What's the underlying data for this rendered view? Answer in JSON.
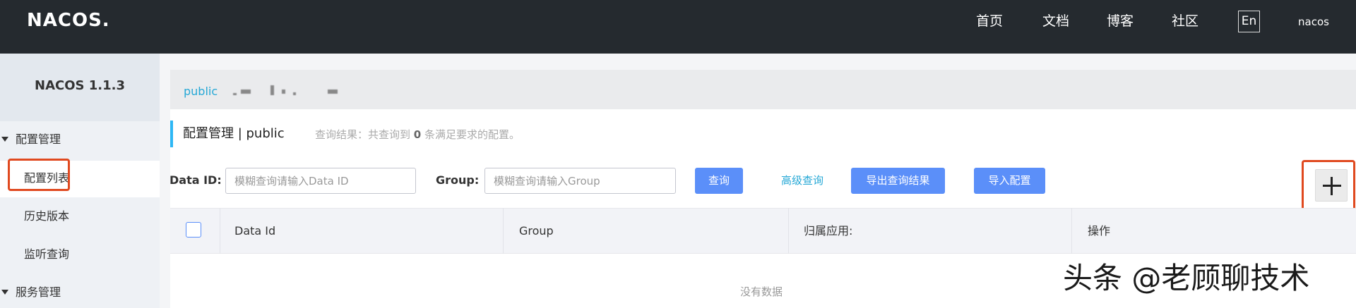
{
  "topbar": {
    "logo": "NACOS.",
    "nav": [
      "首页",
      "文档",
      "博客",
      "社区"
    ],
    "lang_button": "En",
    "user": "nacos"
  },
  "sidebar": {
    "title": "NACOS 1.1.3",
    "groups": [
      {
        "label": "配置管理",
        "items": [
          "配置列表",
          "历史版本",
          "监听查询"
        ]
      },
      {
        "label": "服务管理"
      }
    ]
  },
  "namespace": {
    "active": "public"
  },
  "page": {
    "title": "配置管理 | public",
    "query_result_prefix": "查询结果：共查询到",
    "query_result_count": "0",
    "query_result_suffix": "条满足要求的配置。"
  },
  "filters": {
    "data_id_label": "Data ID:",
    "data_id_placeholder": "模糊查询请输入Data ID",
    "group_label": "Group:",
    "group_placeholder": "模糊查询请输入Group",
    "query_button": "查询",
    "advanced_query": "高级查询",
    "export_button": "导出查询结果",
    "import_button": "导入配置",
    "add_icon": "plus-icon"
  },
  "table": {
    "columns": [
      "Data Id",
      "Group",
      "归属应用:",
      "操作"
    ],
    "empty_text": "没有数据"
  },
  "watermark": "头条 @老顾聊技术",
  "colors": {
    "topbar": "#252a2f",
    "primary_button": "#5b8ff9",
    "link": "#26a8d6",
    "highlight": "#e0491f"
  }
}
